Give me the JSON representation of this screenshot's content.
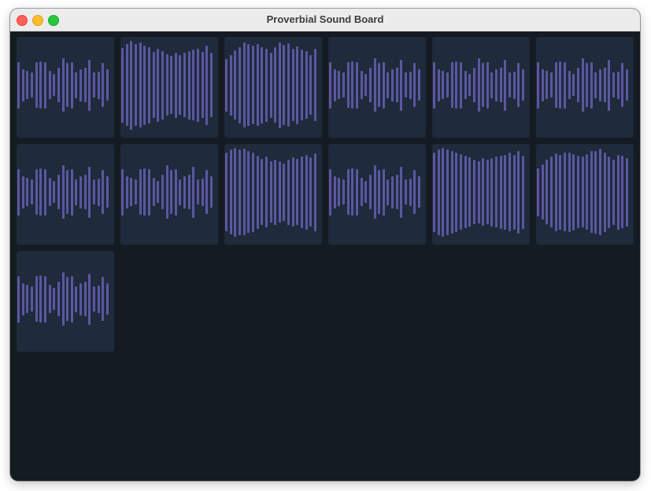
{
  "window": {
    "title": "Proverbial Sound Board"
  },
  "board": {
    "colors": {
      "tile": "#1f2a3b",
      "waveform": "#5b57a0",
      "background": "#151b22"
    },
    "tiles": [
      {
        "waveform": [
          0.46,
          0.32,
          0.28,
          0.25,
          0.45,
          0.47,
          0.46,
          0.28,
          0.22,
          0.34,
          0.53,
          0.44,
          0.46,
          0.26,
          0.32,
          0.34,
          0.51,
          0.25,
          0.27,
          0.44,
          0.31
        ]
      },
      {
        "waveform": [
          0.74,
          0.81,
          0.88,
          0.81,
          0.84,
          0.79,
          0.76,
          0.66,
          0.73,
          0.68,
          0.61,
          0.58,
          0.65,
          0.59,
          0.64,
          0.68,
          0.7,
          0.73,
          0.66,
          0.79,
          0.64
        ]
      },
      {
        "waveform": [
          0.52,
          0.6,
          0.69,
          0.76,
          0.84,
          0.81,
          0.78,
          0.81,
          0.76,
          0.73,
          0.65,
          0.75,
          0.85,
          0.8,
          0.83,
          0.72,
          0.77,
          0.7,
          0.67,
          0.59,
          0.72
        ]
      },
      {
        "waveform": [
          0.46,
          0.32,
          0.28,
          0.25,
          0.45,
          0.47,
          0.46,
          0.28,
          0.22,
          0.34,
          0.53,
          0.44,
          0.46,
          0.26,
          0.32,
          0.34,
          0.51,
          0.25,
          0.27,
          0.44,
          0.31
        ]
      },
      {
        "waveform": [
          0.46,
          0.32,
          0.28,
          0.25,
          0.45,
          0.47,
          0.46,
          0.28,
          0.22,
          0.34,
          0.53,
          0.44,
          0.46,
          0.26,
          0.32,
          0.34,
          0.51,
          0.25,
          0.27,
          0.44,
          0.31
        ]
      },
      {
        "waveform": [
          0.46,
          0.32,
          0.28,
          0.25,
          0.45,
          0.47,
          0.46,
          0.28,
          0.22,
          0.34,
          0.53,
          0.44,
          0.46,
          0.26,
          0.32,
          0.34,
          0.51,
          0.25,
          0.27,
          0.44,
          0.31
        ]
      },
      {
        "waveform": [
          0.46,
          0.32,
          0.28,
          0.25,
          0.45,
          0.47,
          0.46,
          0.28,
          0.22,
          0.34,
          0.53,
          0.44,
          0.46,
          0.26,
          0.32,
          0.34,
          0.51,
          0.25,
          0.27,
          0.44,
          0.31
        ]
      },
      {
        "waveform": [
          0.46,
          0.32,
          0.28,
          0.25,
          0.45,
          0.47,
          0.46,
          0.28,
          0.22,
          0.34,
          0.53,
          0.44,
          0.46,
          0.26,
          0.32,
          0.34,
          0.51,
          0.25,
          0.27,
          0.44,
          0.31
        ]
      },
      {
        "waveform": [
          0.78,
          0.84,
          0.88,
          0.85,
          0.86,
          0.81,
          0.79,
          0.73,
          0.66,
          0.7,
          0.61,
          0.65,
          0.61,
          0.57,
          0.65,
          0.69,
          0.66,
          0.71,
          0.74,
          0.69,
          0.77
        ]
      },
      {
        "waveform": [
          0.46,
          0.32,
          0.28,
          0.25,
          0.45,
          0.47,
          0.46,
          0.28,
          0.22,
          0.34,
          0.53,
          0.44,
          0.46,
          0.26,
          0.32,
          0.34,
          0.51,
          0.25,
          0.27,
          0.44,
          0.31
        ]
      },
      {
        "waveform": [
          0.79,
          0.85,
          0.88,
          0.85,
          0.82,
          0.79,
          0.75,
          0.72,
          0.69,
          0.64,
          0.62,
          0.67,
          0.64,
          0.68,
          0.7,
          0.73,
          0.74,
          0.78,
          0.74,
          0.82,
          0.73
        ]
      },
      {
        "waveform": [
          0.48,
          0.55,
          0.64,
          0.7,
          0.77,
          0.74,
          0.78,
          0.79,
          0.76,
          0.72,
          0.7,
          0.75,
          0.81,
          0.82,
          0.86,
          0.79,
          0.71,
          0.65,
          0.74,
          0.72,
          0.68
        ]
      },
      {
        "waveform": [
          0.46,
          0.32,
          0.28,
          0.25,
          0.45,
          0.47,
          0.46,
          0.28,
          0.22,
          0.34,
          0.53,
          0.44,
          0.46,
          0.26,
          0.32,
          0.34,
          0.51,
          0.25,
          0.27,
          0.44,
          0.31
        ]
      }
    ]
  }
}
